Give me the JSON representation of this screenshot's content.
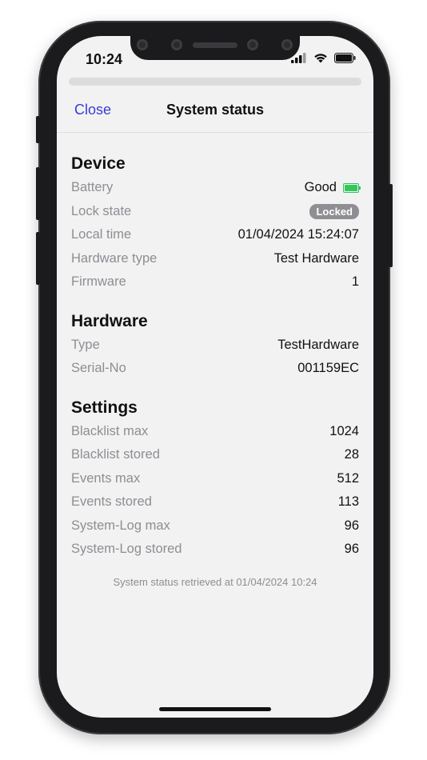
{
  "status_bar": {
    "time": "10:24",
    "icons": [
      "signal-icon",
      "wifi-icon",
      "battery-icon"
    ]
  },
  "nav": {
    "close_label": "Close",
    "title": "System status"
  },
  "sections": {
    "device": {
      "title": "Device",
      "rows": [
        {
          "label": "Battery",
          "value": "Good"
        },
        {
          "label": "Lock state",
          "value": "Locked"
        },
        {
          "label": "Local time",
          "value": "01/04/2024 15:24:07"
        },
        {
          "label": "Hardware type",
          "value": "Test Hardware"
        },
        {
          "label": "Firmware",
          "value": "1"
        }
      ]
    },
    "hardware": {
      "title": "Hardware",
      "rows": [
        {
          "label": "Type",
          "value": "TestHardware"
        },
        {
          "label": "Serial-No",
          "value": "001159EC"
        }
      ]
    },
    "settings": {
      "title": "Settings",
      "rows": [
        {
          "label": "Blacklist max",
          "value": "1024"
        },
        {
          "label": "Blacklist stored",
          "value": "28"
        },
        {
          "label": "Events max",
          "value": "512"
        },
        {
          "label": "Events stored",
          "value": "113"
        },
        {
          "label": "System-Log max",
          "value": "96"
        },
        {
          "label": "System-Log stored",
          "value": "96"
        }
      ]
    }
  },
  "footer": "System status retrieved at 01/04/2024 10:24",
  "colors": {
    "accent": "#3b3bd6",
    "battery_good": "#34c759",
    "badge": "#8e8e93"
  }
}
